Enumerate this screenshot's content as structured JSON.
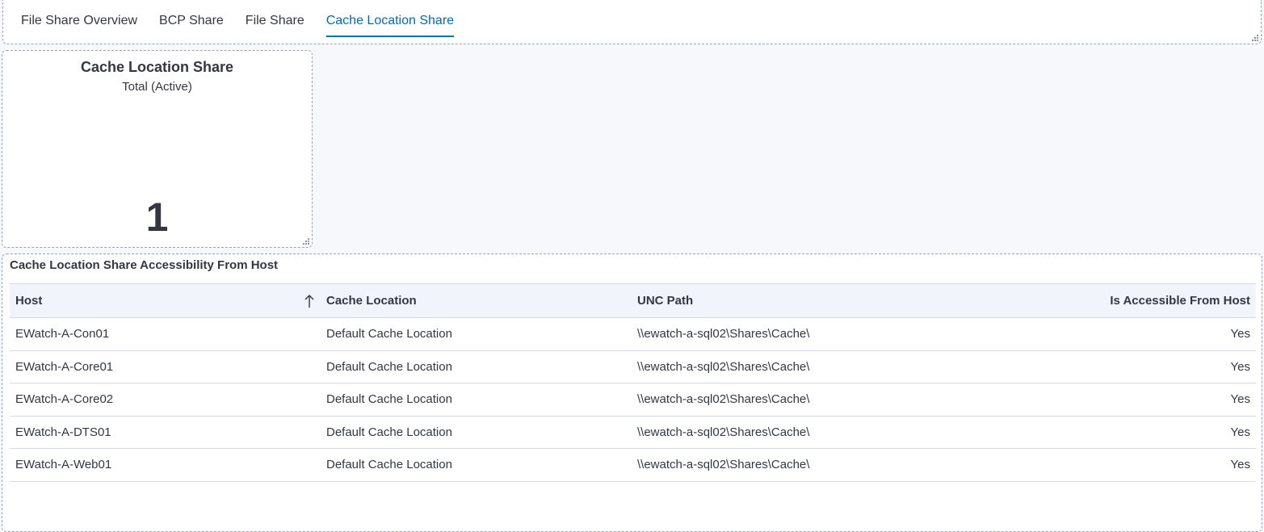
{
  "tabs": [
    {
      "label": "File Share Overview",
      "active": false
    },
    {
      "label": "BCP Share",
      "active": false
    },
    {
      "label": "File Share",
      "active": false
    },
    {
      "label": "Cache Location Share",
      "active": true
    }
  ],
  "metric": {
    "title": "Cache Location Share",
    "subtitle": "Total (Active)",
    "value": "1"
  },
  "table": {
    "title": "Cache Location Share Accessibility From Host",
    "columns": [
      "Host",
      "Cache Location",
      "UNC Path",
      "Is Accessible From Host"
    ],
    "sort": {
      "column": "Host",
      "icon": "sort-ascending-icon"
    },
    "rows": [
      [
        "EWatch-A-Con01",
        "Default Cache Location",
        "\\\\ewatch-a-sql02\\Shares\\Cache\\",
        "Yes"
      ],
      [
        "EWatch-A-Core01",
        "Default Cache Location",
        "\\\\ewatch-a-sql02\\Shares\\Cache\\",
        "Yes"
      ],
      [
        "EWatch-A-Core02",
        "Default Cache Location",
        "\\\\ewatch-a-sql02\\Shares\\Cache\\",
        "Yes"
      ],
      [
        "EWatch-A-DTS01",
        "Default Cache Location",
        "\\\\ewatch-a-sql02\\Shares\\Cache\\",
        "Yes"
      ],
      [
        "EWatch-A-Web01",
        "Default Cache Location",
        "\\\\ewatch-a-sql02\\Shares\\Cache\\",
        "Yes"
      ]
    ]
  },
  "colors": {
    "accent": "#006bb8",
    "text": "#343741",
    "background": "#f7f8fc",
    "header_bg": "#f1f4fa"
  }
}
